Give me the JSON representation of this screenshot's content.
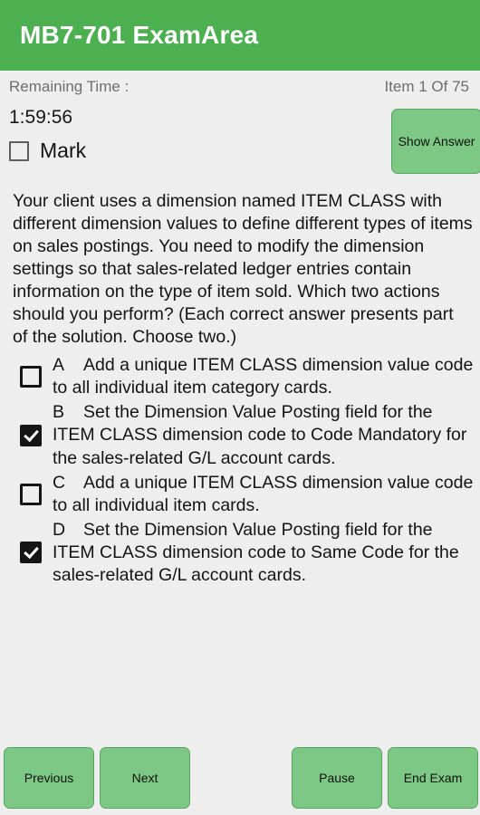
{
  "app_bar": {
    "title": "MB7-701 ExamArea",
    "background_color": "#4CAF50",
    "title_color": "#FFFFFF"
  },
  "status_row": {
    "remaining_time_label": "Remaining Time :",
    "item_counter": "Item 1 Of 75"
  },
  "meta": {
    "timer_value": "1:59:56",
    "mark_label": "Mark",
    "mark_checked": false,
    "show_answer_label": "Show Answer"
  },
  "question": {
    "text": "Your client uses a dimension named ITEM CLASS with different dimension values to define different types of items on sales postings. You need to modify the dimension settings so that sales-related ledger entries contain information on the type of item sold. Which two actions should you perform? (Each correct answer presents part of the solution. Choose two.)"
  },
  "options": [
    {
      "letter": "A",
      "text": "Add a unique ITEM CLASS dimension value code to all individual item category cards.",
      "checked": false
    },
    {
      "letter": "B",
      "text": "Set the Dimension Value Posting field for the ITEM CLASS dimension code to Code Mandatory for the sales-related G/L account cards.",
      "checked": true
    },
    {
      "letter": "C",
      "text": "Add a unique ITEM CLASS dimension value code to all individual item cards.",
      "checked": false
    },
    {
      "letter": "D",
      "text": "Set the Dimension Value Posting field for the ITEM CLASS dimension code to Same Code for the sales-related G/L account cards.",
      "checked": true
    }
  ],
  "buttons": {
    "previous_label": "Previous",
    "next_label": "Next",
    "pause_label": "Pause",
    "end_exam_label": "End Exam",
    "button_color": "#7DC884"
  }
}
